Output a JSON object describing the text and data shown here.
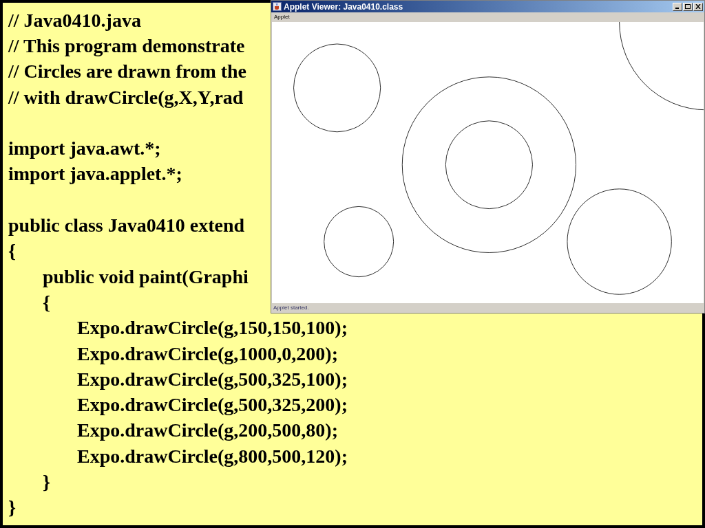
{
  "code": [
    {
      "kind": "line",
      "text": "// Java0410.java"
    },
    {
      "kind": "line",
      "text": "// This program demonstrate"
    },
    {
      "kind": "line",
      "text": "// Circles are drawn from the"
    },
    {
      "kind": "line",
      "text": "// with drawCircle(g,X,Y,rad"
    },
    {
      "kind": "blank"
    },
    {
      "kind": "line",
      "text": "import java.awt.*;"
    },
    {
      "kind": "line",
      "text": "import java.applet.*;"
    },
    {
      "kind": "blank"
    },
    {
      "kind": "line",
      "text": "public class Java0410 extend"
    },
    {
      "kind": "line",
      "text": "{",
      "children": [
        {
          "kind": "line",
          "text": "public void paint(Graphi"
        },
        {
          "kind": "line",
          "text": "{",
          "children": [
            {
              "kind": "line",
              "text": "Expo.drawCircle(g,150,150,100);"
            },
            {
              "kind": "line",
              "text": "Expo.drawCircle(g,1000,0,200);"
            },
            {
              "kind": "line",
              "text": "Expo.drawCircle(g,500,325,100);"
            },
            {
              "kind": "line",
              "text": "Expo.drawCircle(g,500,325,200);"
            },
            {
              "kind": "line",
              "text": "Expo.drawCircle(g,200,500,80);"
            },
            {
              "kind": "line",
              "text": "Expo.drawCircle(g,800,500,120);"
            }
          ]
        },
        {
          "kind": "line",
          "text": "}"
        }
      ]
    },
    {
      "kind": "line",
      "text": "}"
    }
  ],
  "window": {
    "title": "Applet Viewer: Java0410.class",
    "menu": [
      "Applet"
    ],
    "status": "Applet started."
  }
}
